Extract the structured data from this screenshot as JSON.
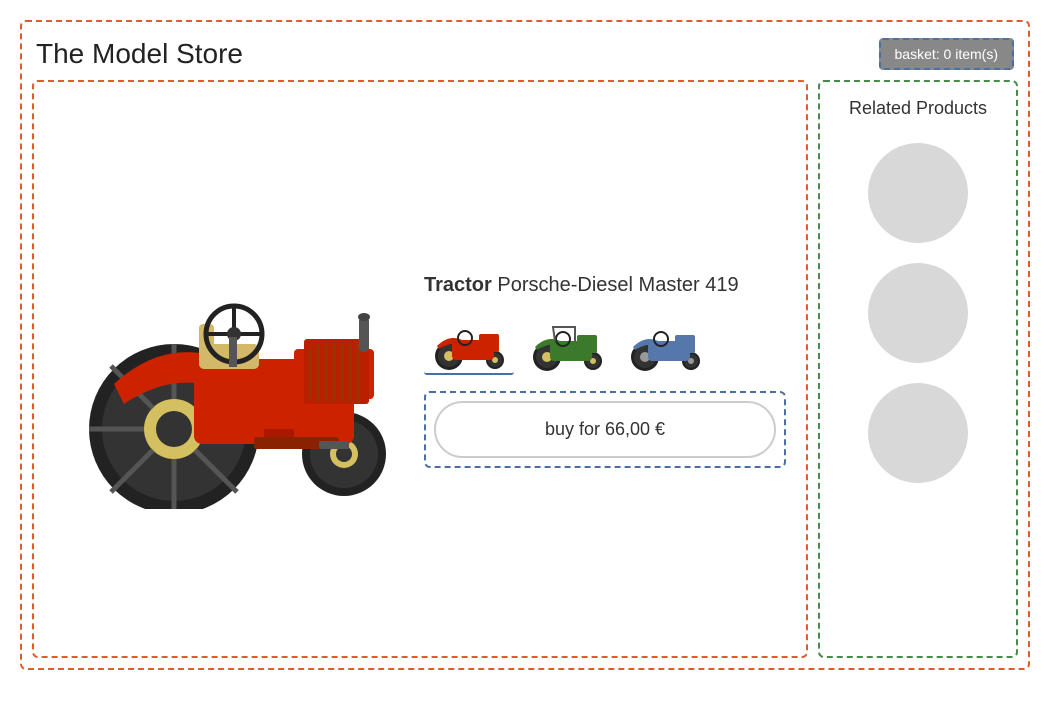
{
  "header": {
    "store_title": "The Model Store",
    "basket_label": "basket: 0 item(s)"
  },
  "product": {
    "name_bold": "Tractor",
    "name_rest": " Porsche-Diesel Master 419",
    "buy_button_label": "buy for 66,00 €",
    "thumbnails": [
      {
        "label": "red tractor thumbnail",
        "color": "#cc2200"
      },
      {
        "label": "green tractor thumbnail",
        "color": "#3a7a2a"
      },
      {
        "label": "blue tractor thumbnail",
        "color": "#5577aa"
      }
    ]
  },
  "related": {
    "title": "Related Products",
    "placeholders": [
      {
        "label": "related product 1"
      },
      {
        "label": "related product 2"
      },
      {
        "label": "related product 3"
      }
    ]
  }
}
